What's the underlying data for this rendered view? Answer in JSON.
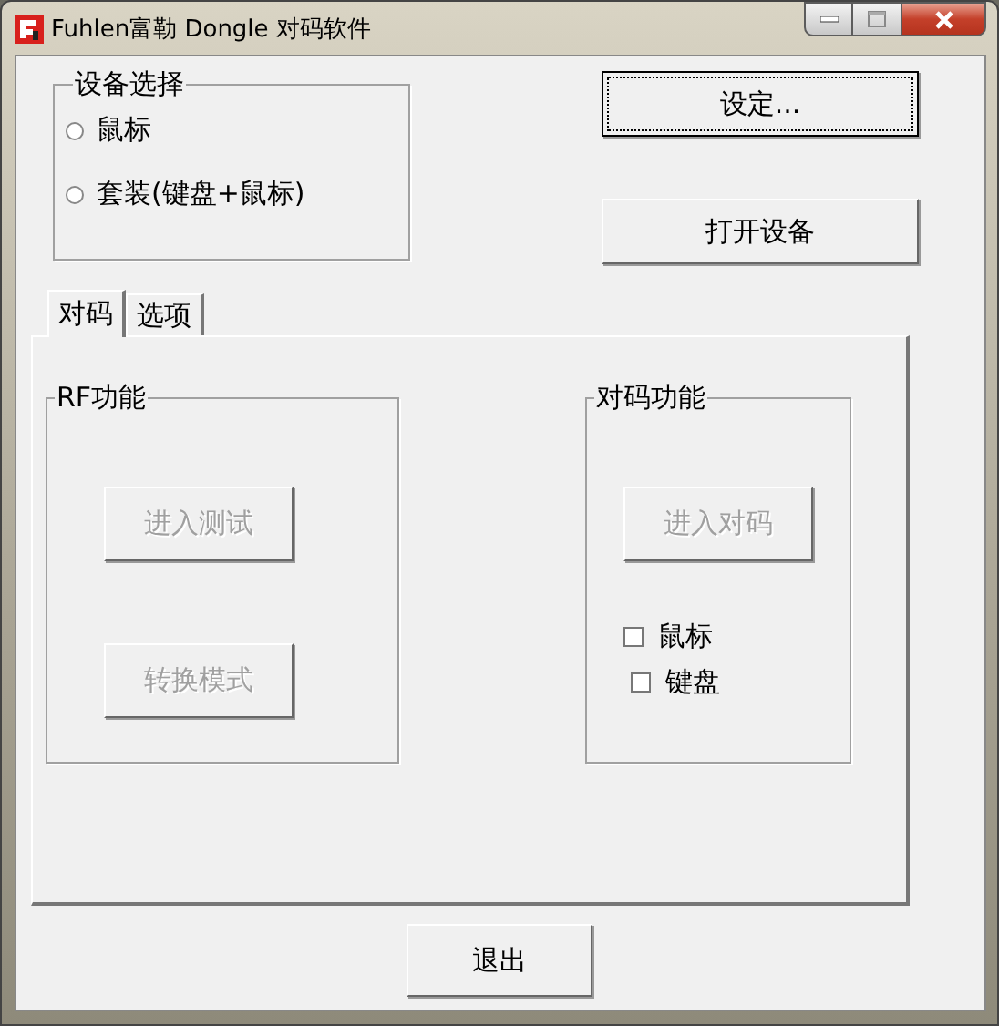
{
  "window": {
    "title": "Fuhlen富勒 Dongle 对码软件"
  },
  "device_group": {
    "title": "设备选择",
    "options": [
      {
        "label": "鼠标",
        "selected": false
      },
      {
        "label": "套装(键盘+鼠标)",
        "selected": false
      }
    ]
  },
  "top_buttons": [
    {
      "label": "设定...",
      "focused": true
    },
    {
      "label": "打开设备",
      "focused": false
    }
  ],
  "tabs": [
    {
      "label": "对码",
      "selected": true
    },
    {
      "label": "选项",
      "selected": false
    }
  ],
  "rf_group": {
    "title": "RF功能",
    "buttons": [
      {
        "label": "进入测试",
        "disabled": true
      },
      {
        "label": "转换模式",
        "disabled": true
      }
    ]
  },
  "pair_group": {
    "title": "对码功能",
    "button": {
      "label": "进入对码",
      "disabled": true
    },
    "checkboxes": [
      {
        "label": "鼠标",
        "checked": false
      },
      {
        "label": "键盘",
        "checked": false
      }
    ]
  },
  "exit_button": {
    "label": "退出"
  }
}
